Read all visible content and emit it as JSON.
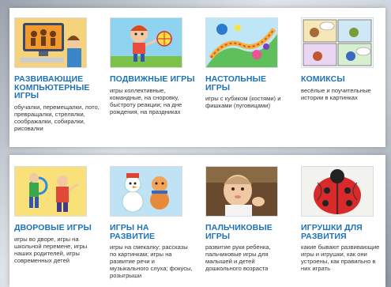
{
  "top_row": [
    {
      "title": "РАЗВИВАЮЩИЕ КОМПЬЮТЕРНЫЕ ИГРЫ",
      "desc": "обучалки, перемещалки, лото, превращалки, стрелялки, соображалки, собиралки, рисовалки",
      "thumb_icon": "computer-kids-icon"
    },
    {
      "title": "ПОДВИЖНЫЕ ИГРЫ",
      "desc": "игры коллективные, командные, на сноровку, быстроту реакции; на дне рождения, на праздниках",
      "thumb_icon": "ball-kid-icon"
    },
    {
      "title": "НАСТОЛЬНЫЕ ИГРЫ",
      "desc": "игры с кубиком (костями) и фишками (пуговицами)",
      "thumb_icon": "board-game-icon"
    },
    {
      "title": "КОМИКСЫ",
      "desc": "весёлые и поучительные истории в картинках",
      "thumb_icon": "comics-icon"
    }
  ],
  "bottom_row": [
    {
      "title": "ДВОРОВЫЕ ИГРЫ",
      "desc": "игры во дворе, игры на школьной перемене, игры наших родителей, игры современных детей",
      "thumb_icon": "yard-kids-icon"
    },
    {
      "title": "ИГРЫ НА РАЗВИТИЕ",
      "desc": "игры на смекалку; рассказы по картинкам; игры на развитие речи и музыкального слуха; фокусы, розыгрыши",
      "thumb_icon": "snowman-icon"
    },
    {
      "title": "ПАЛЬЧИКОВЫЕ ИГРЫ",
      "desc": "развитие руки ребенка, пальчиковые игры для малышей и детей дошкольного возраста",
      "thumb_icon": "baby-hands-icon"
    },
    {
      "title": "ИГРУШКИ ДЛЯ РАЗВИТИЯ",
      "desc": "какие бывают развивающие игры и игрушки, как они устроены, как правильно в них играть",
      "thumb_icon": "ladybug-toy-icon"
    }
  ],
  "colors": {
    "title": "#1e72b8",
    "text": "#333333"
  }
}
